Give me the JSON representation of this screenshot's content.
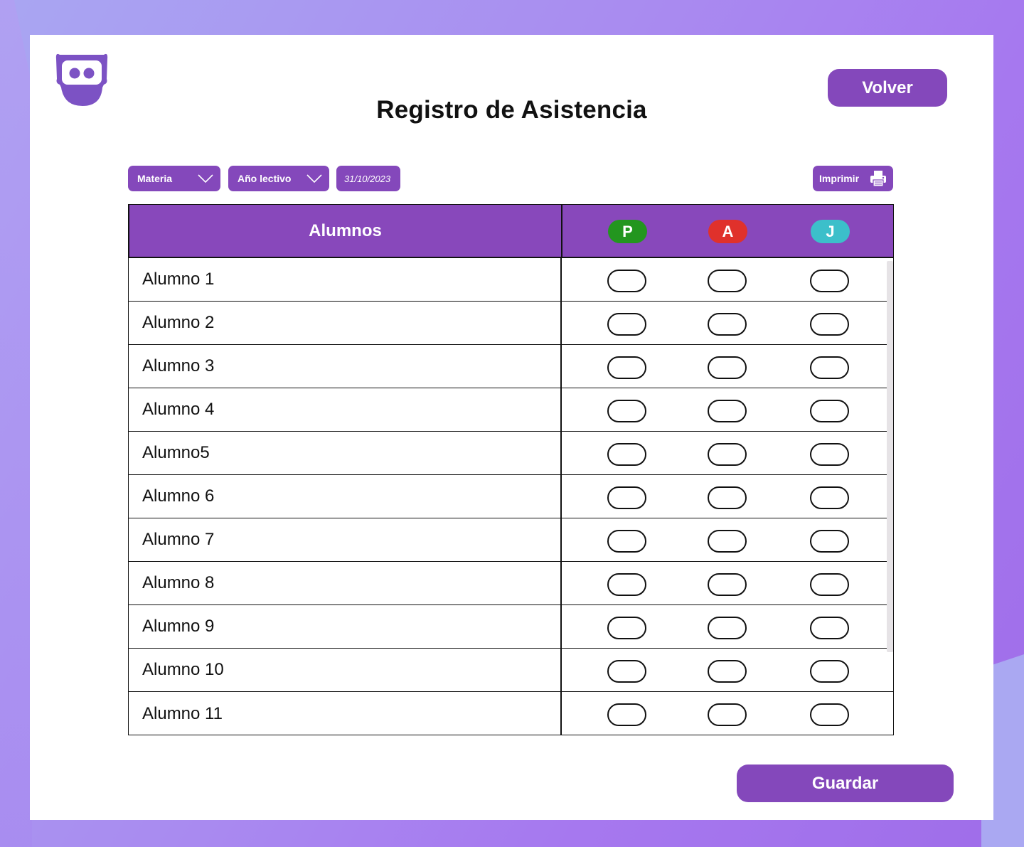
{
  "page": {
    "title": "Registro de Asistencia",
    "back_button": "Volver",
    "save_button": "Guardar"
  },
  "filters": {
    "materia": "Materia",
    "anio_lectivo": "Año lectivo",
    "fecha": "31/10/2023",
    "imprimir": "Imprimir"
  },
  "table": {
    "header": "Alumnos",
    "columns": [
      {
        "label": "P",
        "color": "#23961f"
      },
      {
        "label": "A",
        "color": "#e0312b"
      },
      {
        "label": "J",
        "color": "#3cbfca"
      }
    ],
    "rows": [
      {
        "name": "Alumno 1",
        "p": false,
        "a": false,
        "j": false
      },
      {
        "name": "Alumno 2",
        "p": false,
        "a": false,
        "j": false
      },
      {
        "name": "Alumno 3",
        "p": false,
        "a": false,
        "j": false
      },
      {
        "name": "Alumno 4",
        "p": false,
        "a": false,
        "j": false
      },
      {
        "name": "Alumno5",
        "p": false,
        "a": false,
        "j": false
      },
      {
        "name": "Alumno 6",
        "p": false,
        "a": false,
        "j": false
      },
      {
        "name": "Alumno 7",
        "p": false,
        "a": false,
        "j": false
      },
      {
        "name": "Alumno 8",
        "p": false,
        "a": false,
        "j": false
      },
      {
        "name": "Alumno 9",
        "p": false,
        "a": false,
        "j": false
      },
      {
        "name": "Alumno 10",
        "p": false,
        "a": false,
        "j": false
      },
      {
        "name": "Alumno 11",
        "p": false,
        "a": false,
        "j": false
      }
    ]
  },
  "colors": {
    "accent": "#8448bb",
    "background_gradient_start": "#a9a6f2",
    "background_gradient_end": "#9f6de9"
  },
  "icons": {
    "logo": "owl-logo-icon",
    "dropdown": "chevron-down-icon",
    "print": "printer-icon"
  }
}
